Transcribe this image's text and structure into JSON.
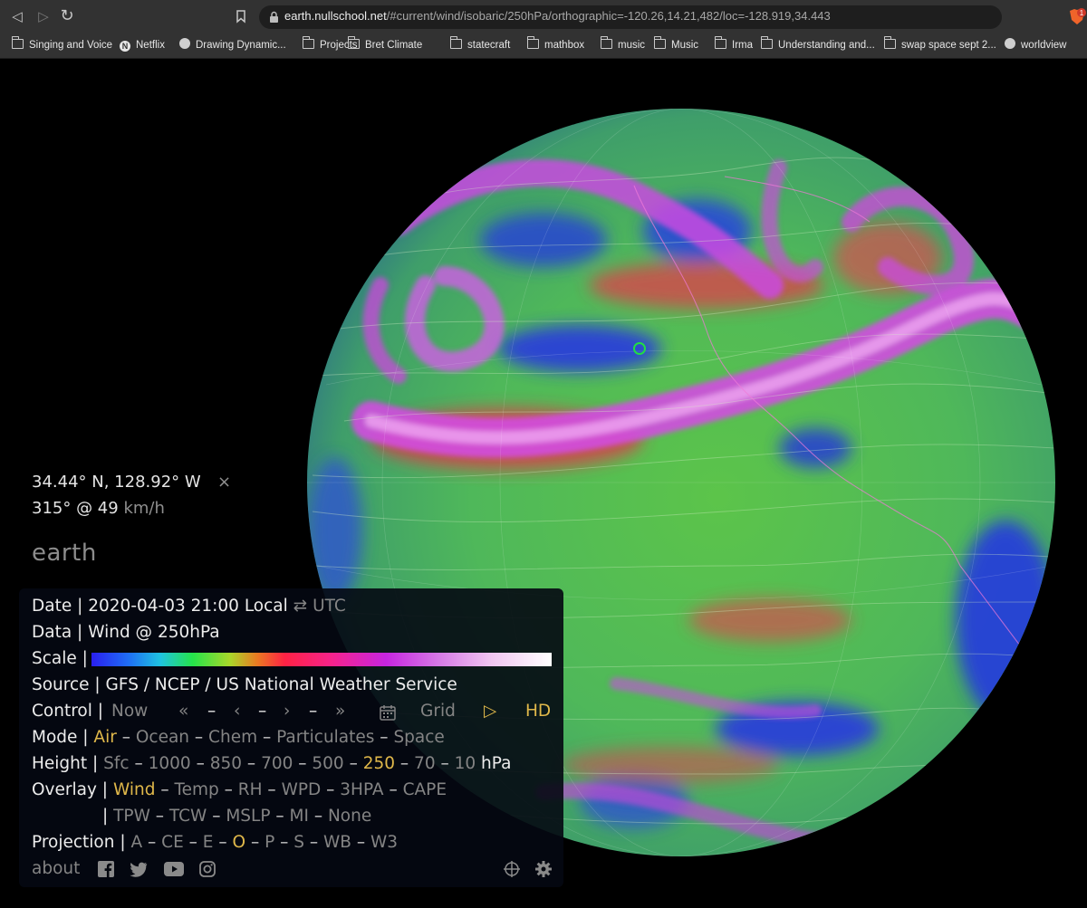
{
  "browser": {
    "url_host": "earth.nullschool.net",
    "url_rest": "/#current/wind/isobaric/250hPa/orthographic=-120.26,14.21,482/loc=-128.919,34.443",
    "extension_badge": "1",
    "bookmarks": [
      {
        "label": "Singing and Voice",
        "icon": "folder-icon"
      },
      {
        "label": "Netflix",
        "icon": "netflix-icon"
      },
      {
        "label": "Drawing Dynamic...",
        "icon": "globe-icon"
      },
      {
        "label": "Projects",
        "icon": "folder-icon"
      },
      {
        "label": "Bret Climate",
        "icon": "folder-icon"
      },
      {
        "label": "statecraft",
        "icon": "folder-icon"
      },
      {
        "label": "mathbox",
        "icon": "folder-icon"
      },
      {
        "label": "music",
        "icon": "folder-icon"
      },
      {
        "label": "Music",
        "icon": "folder-icon"
      },
      {
        "label": "Irma",
        "icon": "folder-icon"
      },
      {
        "label": "Understanding and...",
        "icon": "folder-icon"
      },
      {
        "label": "swap space sept 2...",
        "icon": "folder-icon"
      },
      {
        "label": "worldview",
        "icon": "globe-icon"
      }
    ]
  },
  "location": {
    "latlon": "34.44° N, 128.92° W",
    "close": "×",
    "wind_value": "315° @ 49",
    "wind_unit": "km/h"
  },
  "title": "earth",
  "menu": {
    "date": {
      "label": "Date |",
      "value": "2020-04-03 21:00 Local",
      "swap": "⇄",
      "alt": "UTC"
    },
    "data": {
      "label": "Data |",
      "value": "Wind @ 250hPa"
    },
    "scale": {
      "label": "Scale |"
    },
    "source": {
      "label": "Source |",
      "value": "GFS / NCEP / US National Weather Service"
    },
    "control": {
      "label": "Control |",
      "items": [
        "Now",
        "«",
        "–",
        "‹",
        "–",
        "›",
        "–",
        "»"
      ],
      "grid": "Grid",
      "play": "▷",
      "hd": "HD"
    },
    "mode": {
      "label": "Mode |",
      "options": [
        "Air",
        "Ocean",
        "Chem",
        "Particulates",
        "Space"
      ],
      "selected": "Air"
    },
    "height": {
      "label": "Height |",
      "options": [
        "Sfc",
        "1000",
        "850",
        "700",
        "500",
        "250",
        "70",
        "10"
      ],
      "selected": "250",
      "unit": "hPa"
    },
    "overlay": {
      "label": "Overlay |",
      "row1": [
        "Wind",
        "Temp",
        "RH",
        "WPD",
        "3HPA",
        "CAPE"
      ],
      "row2": [
        "TPW",
        "TCW",
        "MSLP",
        "MI",
        "None"
      ],
      "selected": "Wind"
    },
    "projection": {
      "label": "Projection |",
      "options": [
        "A",
        "CE",
        "E",
        "O",
        "P",
        "S",
        "WB",
        "W3"
      ],
      "selected": "O"
    },
    "footer": {
      "about": "about",
      "social_icons": [
        "facebook-icon",
        "twitter-icon",
        "youtube-icon",
        "instagram-icon"
      ],
      "locate_icon": "crosshair-icon",
      "settings_icon": "gear-icon"
    }
  },
  "colors": {
    "selected": "#e0b84a",
    "dim": "#848484",
    "text": "#ececec",
    "marker": "#22dd44"
  }
}
